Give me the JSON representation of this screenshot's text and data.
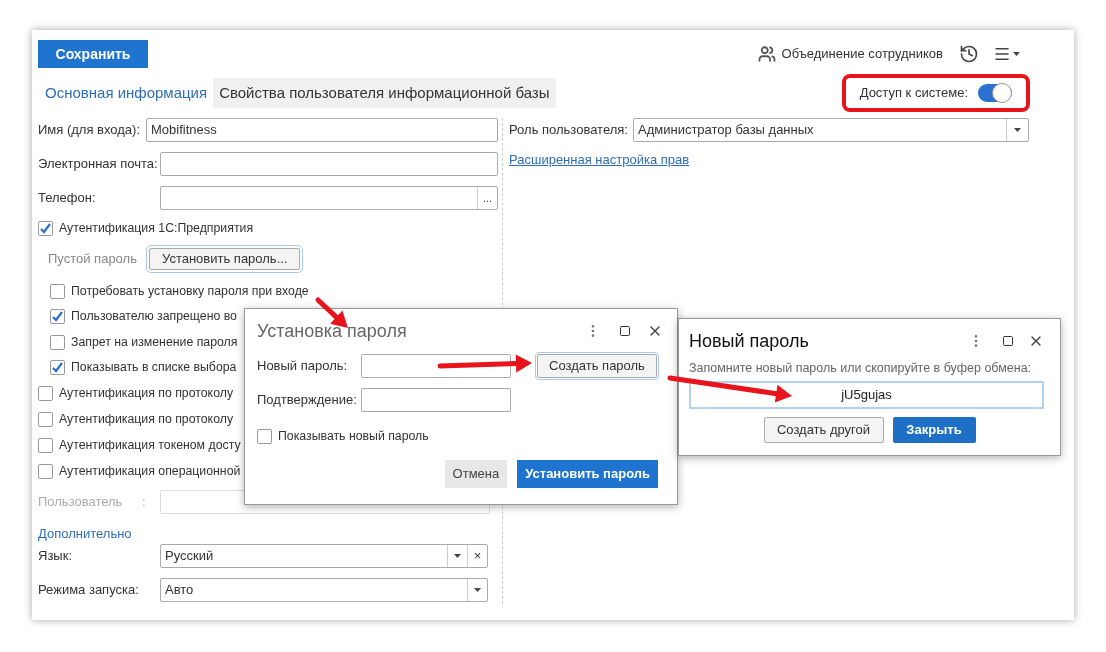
{
  "header": {
    "save_button": "Сохранить",
    "merge_button": "Объединение сотрудников"
  },
  "tabs": [
    {
      "label": "Основная информация",
      "selected": false
    },
    {
      "label": "Свойства пользователя информационной базы",
      "selected": true
    }
  ],
  "access": {
    "label": "Доступ к системе:",
    "on": true
  },
  "name": {
    "label": "Имя (для входа):",
    "value": "Mobifitness"
  },
  "email": {
    "label": "Электронная почта:"
  },
  "phone": {
    "label": "Телефон:",
    "button": "..."
  },
  "auth_1c": {
    "label": "Аутентификация 1С:Предприятия",
    "checked": true
  },
  "empty_password": {
    "label": "Пустой пароль",
    "button": "Установить пароль..."
  },
  "password_options": [
    {
      "label": "Потребовать установку пароля при входе",
      "checked": false
    },
    {
      "label": "Пользователю запрещено во",
      "checked": true
    },
    {
      "label": "Запрет на изменение пароля",
      "checked": false
    },
    {
      "label": "Показывать в списке выбора",
      "checked": true
    }
  ],
  "auth_options": [
    {
      "label": "Аутентификация по протоколу",
      "checked": false
    },
    {
      "label": "Аутентификация по протоколу",
      "checked": false
    },
    {
      "label": "Аутентификация токеном досту",
      "checked": false
    },
    {
      "label": "Аутентификация операционной",
      "checked": false
    }
  ],
  "os_user": {
    "label": "Пользователь",
    "colon": ":",
    "disabled": true
  },
  "additional": "Дополнительно",
  "language": {
    "label": "Язык:",
    "value": "Русский",
    "clear": "×"
  },
  "launch_mode": {
    "label": "Режима запуска:",
    "value": "Авто"
  },
  "role": {
    "label": "Роль пользователя:",
    "value": "Администратор базы данных"
  },
  "rights_link": "Расширенная настройка прав",
  "set_password_dialog": {
    "title": "Установка пароля",
    "new_label": "Новый пароль:",
    "generate_button": "Создать пароль",
    "confirm_label": "Подтверждение:",
    "show_label": "Показывать новый пароль",
    "show_checked": false,
    "cancel_button": "Отмена",
    "ok_button": "Установить пароль"
  },
  "new_password_dialog": {
    "title": "Новый пароль",
    "hint": "Запомните новый пароль или скопируйте в буфер обмена:",
    "password": "jU5gujas",
    "another_button": "Создать другой",
    "close_button": "Закрыть"
  }
}
